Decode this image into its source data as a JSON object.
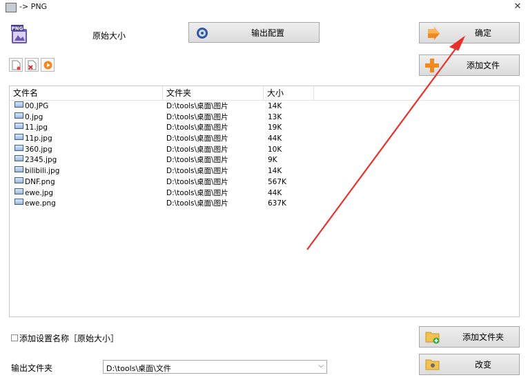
{
  "window": {
    "title": "-> PNG"
  },
  "preset": {
    "label": "原始大小",
    "png_badge": "PNG"
  },
  "buttons": {
    "output_config": "输出配置",
    "confirm": "确定",
    "add_file": "添加文件",
    "add_folder": "添加文件夹",
    "change": "改变"
  },
  "columns": [
    "文件名",
    "文件夹",
    "大小"
  ],
  "files": [
    {
      "name": "00.JPG",
      "folder": "D:\\tools\\桌面\\图片",
      "size": "14K"
    },
    {
      "name": "0.jpg",
      "folder": "D:\\tools\\桌面\\图片",
      "size": "13K"
    },
    {
      "name": "11.jpg",
      "folder": "D:\\tools\\桌面\\图片",
      "size": "19K"
    },
    {
      "name": "11p.jpg",
      "folder": "D:\\tools\\桌面\\图片",
      "size": "44K"
    },
    {
      "name": "360.jpg",
      "folder": "D:\\tools\\桌面\\图片",
      "size": "10K"
    },
    {
      "name": "2345.jpg",
      "folder": "D:\\tools\\桌面\\图片",
      "size": "9K"
    },
    {
      "name": "bilibili.jpg",
      "folder": "D:\\tools\\桌面\\图片",
      "size": "14K"
    },
    {
      "name": "DNF.png",
      "folder": "D:\\tools\\桌面\\图片",
      "size": "567K"
    },
    {
      "name": "ewe.jpg",
      "folder": "D:\\tools\\桌面\\图片",
      "size": "44K"
    },
    {
      "name": "ewe.png",
      "folder": "D:\\tools\\桌面\\图片",
      "size": "637K"
    }
  ],
  "options": {
    "add_setting_name_label": "添加设置名称［原始大小］",
    "add_setting_name_checked": false
  },
  "output": {
    "label": "输出文件夹",
    "folder_value": "D:\\tools\\桌面\\文件"
  },
  "colors": {
    "arrow": "#e8302a",
    "button_face": "#e6e6e6"
  }
}
